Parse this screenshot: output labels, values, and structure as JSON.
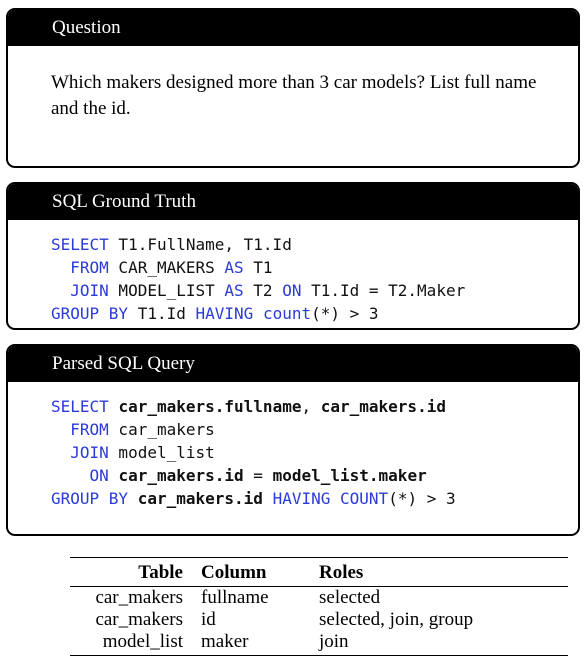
{
  "question": {
    "header": "Question",
    "text": "Which makers designed more than 3 car models? List full name and the id."
  },
  "ground_truth": {
    "header": "SQL Ground Truth",
    "line1": [
      "SELECT",
      " T1.FullName, T1.Id"
    ],
    "line2": [
      "  ",
      "FROM",
      " CAR_MAKERS ",
      "AS",
      " T1"
    ],
    "line3": [
      "  ",
      "JOIN",
      " MODEL_LIST ",
      "AS",
      " T2 ",
      "ON",
      " T1.Id = T2.Maker"
    ],
    "line4": [
      "GROUP BY",
      " T1.Id ",
      "HAVING",
      " ",
      "count",
      "(*) > 3"
    ]
  },
  "parsed": {
    "header": "Parsed SQL Query",
    "line1": [
      "SELECT",
      " ",
      "car_makers.fullname",
      ", ",
      "car_makers.id"
    ],
    "line2": [
      "  ",
      "FROM",
      " car_makers"
    ],
    "line3": [
      "  ",
      "JOIN",
      " model_list"
    ],
    "line4": [
      "    ",
      "ON",
      " ",
      "car_makers.id",
      " = ",
      "model_list.maker"
    ],
    "line5": [
      "GROUP BY",
      " ",
      "car_makers.id",
      " ",
      "HAVING",
      " ",
      "COUNT",
      "(*) > 3"
    ]
  },
  "roles_table": {
    "headers": [
      "Table",
      "Column",
      "Roles"
    ],
    "rows": [
      [
        "car_makers",
        "fullname",
        "selected"
      ],
      [
        "car_makers",
        "id",
        "selected, join, group"
      ],
      [
        "model_list",
        "maker",
        "join"
      ]
    ]
  }
}
